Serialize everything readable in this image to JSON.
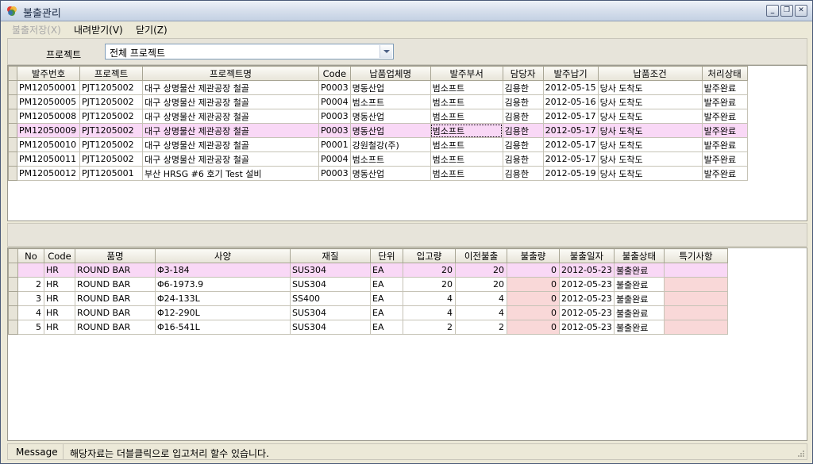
{
  "window": {
    "title": "불출관리"
  },
  "menu": {
    "save": "불출저장(X)",
    "download": "내려받기(V)",
    "close": "닫기(Z)"
  },
  "filter": {
    "label": "프로젝트",
    "value": "전체 프로젝트"
  },
  "orders": {
    "columns": [
      "발주번호",
      "프로젝트",
      "프로젝트명",
      "Code",
      "납품업체명",
      "발주부서",
      "담당자",
      "발주납기",
      "납품조건",
      "처리상태"
    ],
    "rows": [
      [
        "PM12050001",
        "PJT1205002",
        "대구 상명물산 제관공장 철골",
        "P0003",
        "명동산업",
        "범소프트",
        "김용한",
        "2012-05-15",
        "당사 도착도",
        "발주완료"
      ],
      [
        "PM12050005",
        "PJT1205002",
        "대구 상명물산 제관공장 철골",
        "P0004",
        "범소프트",
        "범소프트",
        "김용한",
        "2012-05-16",
        "당사 도착도",
        "발주완료"
      ],
      [
        "PM12050008",
        "PJT1205002",
        "대구 상명물산 제관공장 철골",
        "P0003",
        "명동산업",
        "범소프트",
        "김용한",
        "2012-05-17",
        "당사 도착도",
        "발주완료"
      ],
      [
        "PM12050009",
        "PJT1205002",
        "대구 상명물산 제관공장 철골",
        "P0003",
        "명동산업",
        "범소프트",
        "김용한",
        "2012-05-17",
        "당사 도착도",
        "발주완료"
      ],
      [
        "PM12050010",
        "PJT1205002",
        "대구 상명물산 제관공장 철골",
        "P0001",
        "강원철강(주)",
        "범소프트",
        "김용한",
        "2012-05-17",
        "당사 도착도",
        "발주완료"
      ],
      [
        "PM12050011",
        "PJT1205002",
        "대구 상명물산 제관공장 철골",
        "P0004",
        "범소프트",
        "범소프트",
        "김용한",
        "2012-05-17",
        "당사 도착도",
        "발주완료"
      ],
      [
        "PM12050012",
        "PJT1205001",
        "부산 HRSG #6 호기 Test 설비",
        "P0003",
        "명동산업",
        "범소프트",
        "김용한",
        "2012-05-19",
        "당사 도착도",
        "발주완료"
      ]
    ]
  },
  "items": {
    "columns": [
      "No",
      "Code",
      "품명",
      "사양",
      "재질",
      "단위",
      "입고량",
      "이전불출",
      "불출량",
      "불출일자",
      "불출상태",
      "특기사항"
    ],
    "rows": [
      [
        "",
        "HR",
        "ROUND BAR",
        "Φ3-184",
        "SUS304",
        "EA",
        "20",
        "20",
        "0",
        "2012-05-23",
        "불출완료",
        ""
      ],
      [
        "2",
        "HR",
        "ROUND BAR",
        "Φ6-1973.9",
        "SUS304",
        "EA",
        "20",
        "20",
        "0",
        "2012-05-23",
        "불출완료",
        ""
      ],
      [
        "3",
        "HR",
        "ROUND BAR",
        "Φ24-133L",
        "SS400",
        "EA",
        "4",
        "4",
        "0",
        "2012-05-23",
        "불출완료",
        ""
      ],
      [
        "4",
        "HR",
        "ROUND BAR",
        "Φ12-290L",
        "SUS304",
        "EA",
        "4",
        "4",
        "0",
        "2012-05-23",
        "불출완료",
        ""
      ],
      [
        "5",
        "HR",
        "ROUND BAR",
        "Φ16-541L",
        "SUS304",
        "EA",
        "2",
        "2",
        "0",
        "2012-05-23",
        "불출완료",
        ""
      ]
    ]
  },
  "status": {
    "label": "Message",
    "text": "해당자료는 더블클릭으로 입고처리 할수 있습니다."
  },
  "colors": {
    "selected_row": "#f9d8f6",
    "editable_cell": "#f9d8d8"
  }
}
